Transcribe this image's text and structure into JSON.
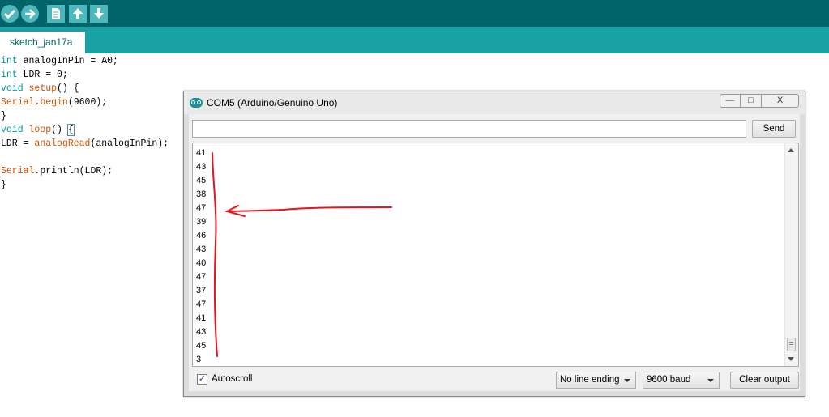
{
  "toolbar": {
    "buttons": [
      {
        "name": "verify",
        "icon": "check-icon"
      },
      {
        "name": "upload",
        "icon": "arrow-right-icon"
      },
      {
        "name": "new",
        "icon": "new-file-icon"
      },
      {
        "name": "open",
        "icon": "upload-arrow-icon"
      },
      {
        "name": "save",
        "icon": "download-arrow-icon"
      }
    ]
  },
  "tabs": [
    {
      "label": "sketch_jan17a"
    }
  ],
  "code": {
    "line1_kw": "int",
    "line1_rest": " analogInPin = A0;",
    "line2_kw": "int",
    "line2_rest": " LDR = 0;",
    "line3_kw": "void",
    "line3_fn": "setup",
    "line3_rest": "() {",
    "line4_fn": "Serial",
    "line4_dot": ".",
    "line4_method": "begin",
    "line4_rest": "(9600);",
    "line5": "}",
    "line6_kw": "void",
    "line6_fn": "loop",
    "line6_rest": "() ",
    "line6_brace": "{",
    "line7_pre": "LDR = ",
    "line7_fn": "analogRead",
    "line7_rest": "(analogInPin);",
    "line9_fn": "Serial",
    "line9_dot": ".",
    "line9_method": "println",
    "line9_rest": "(LDR);",
    "line10": "}"
  },
  "serial_monitor": {
    "title": "COM5 (Arduino/Genuino Uno)",
    "window_controls": {
      "minimize": "—",
      "maximize": "□",
      "close": "X"
    },
    "input_value": "",
    "send_label": "Send",
    "output_lines": [
      "41",
      "43",
      "45",
      "38",
      "47",
      "39",
      "46",
      "43",
      "40",
      "47",
      "37",
      "47",
      "41",
      "43",
      "45",
      "3"
    ],
    "autoscroll_label": "Autoscroll",
    "autoscroll_checked": "✓",
    "line_ending": "No line ending",
    "baud": "9600 baud",
    "clear_label": "Clear output"
  },
  "colors": {
    "toolbar": "#006468",
    "tabbar": "#17a1a5",
    "button": "#4db7bb",
    "annotation": "#e8141b"
  }
}
